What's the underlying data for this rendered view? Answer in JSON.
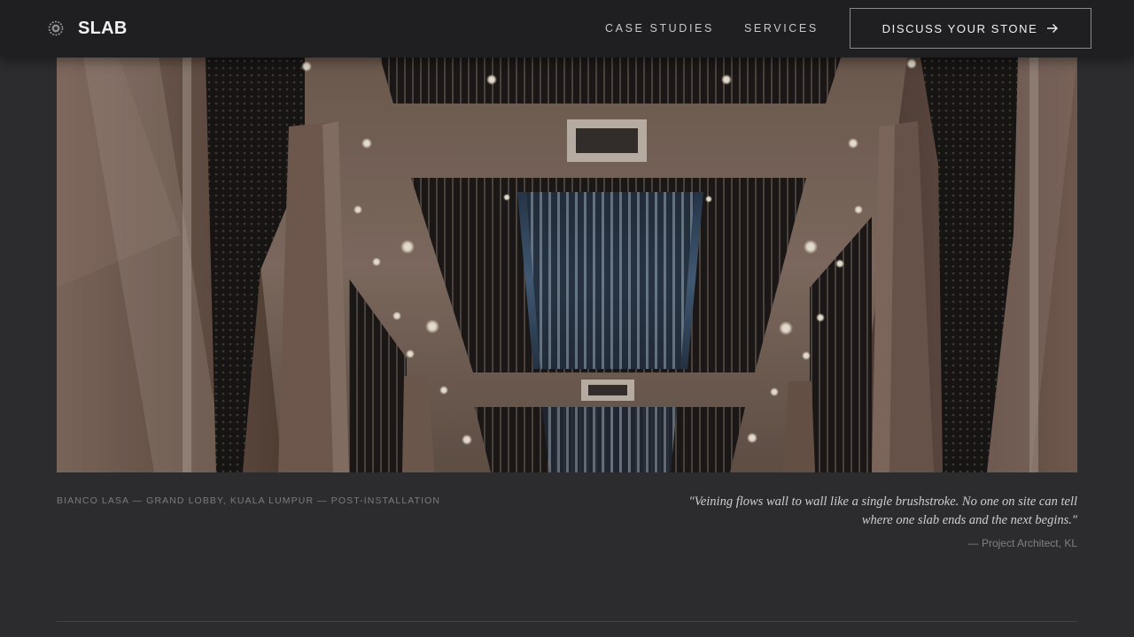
{
  "brand": {
    "name": "SLAB",
    "logo_icon": "sunburst-seal-icon"
  },
  "nav": {
    "links": [
      {
        "label": "CASE STUDIES"
      },
      {
        "label": "SERVICES"
      }
    ],
    "cta": {
      "label": "DISCUSS YOUR STONE",
      "icon": "arrow-right-icon"
    }
  },
  "hero": {
    "image": "photo of a lobby ceiling with recessed lights, timber-clad columns and blue-lit slatted ceiling panels"
  },
  "caption": "BIANCO LASA — GRAND LOBBY, KUALA LUMPUR — POST-INSTALLATION",
  "testimonial": {
    "quote_line1": "\"Veining flows wall to wall like a single brushstroke. No one on site can tell",
    "quote_line2": "where one slab ends and the next begins.\"",
    "author": "— Project Architect, KL"
  },
  "colors": {
    "nav_background": "#1f1f21",
    "page_background": "#2c2c2e",
    "text_primary": "#f2f2f2",
    "text_muted": "#7c7c80"
  }
}
